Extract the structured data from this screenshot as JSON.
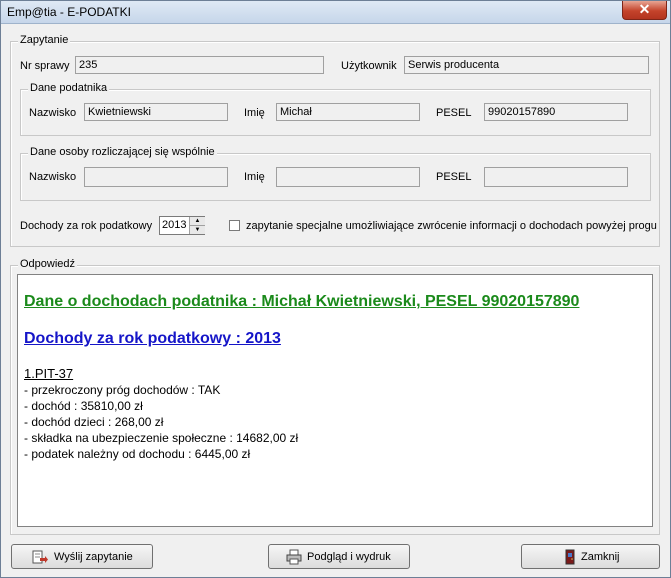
{
  "window": {
    "title": "Emp@tia - E-PODATKI",
    "close_label": "✕"
  },
  "query": {
    "legend": "Zapytanie",
    "case_no_label": "Nr sprawy",
    "case_no_value": "235",
    "user_label": "Użytkownik",
    "user_value": "Serwis producenta",
    "taxpayer": {
      "legend": "Dane podatnika",
      "surname_label": "Nazwisko",
      "surname_value": "Kwietniewski",
      "name_label": "Imię",
      "name_value": "Michał",
      "pesel_label": "PESEL",
      "pesel_value": "99020157890"
    },
    "joint": {
      "legend": "Dane osoby rozliczającej się wspólnie",
      "surname_label": "Nazwisko",
      "surname_value": "",
      "name_label": "Imię",
      "name_value": "",
      "pesel_label": "PESEL",
      "pesel_value": ""
    },
    "year_label": "Dochody za rok podatkowy",
    "year_value": "2013",
    "special_checked": false,
    "special_label": "zapytanie specjalne umożliwiające zwrócenie informacji o dochodach powyżej progu"
  },
  "answer": {
    "legend": "Odpowiedź",
    "heading_taxpayer": "Dane o dochodach podatnika : Michał Kwietniewski, PESEL 99020157890",
    "heading_year": "Dochody za rok podatkowy : 2013",
    "pit_title": "1.PIT-37",
    "lines": [
      "- przekroczony próg dochodów : TAK",
      "- dochód : 35810,00 zł",
      "- dochód dzieci : 268,00 zł",
      "- składka na ubezpieczenie społeczne : 14682,00 zł",
      "- podatek należny od dochodu : 6445,00 zł"
    ]
  },
  "buttons": {
    "send": "Wyślij zapytanie",
    "preview": "Podgląd i wydruk",
    "close": "Zamknij"
  }
}
